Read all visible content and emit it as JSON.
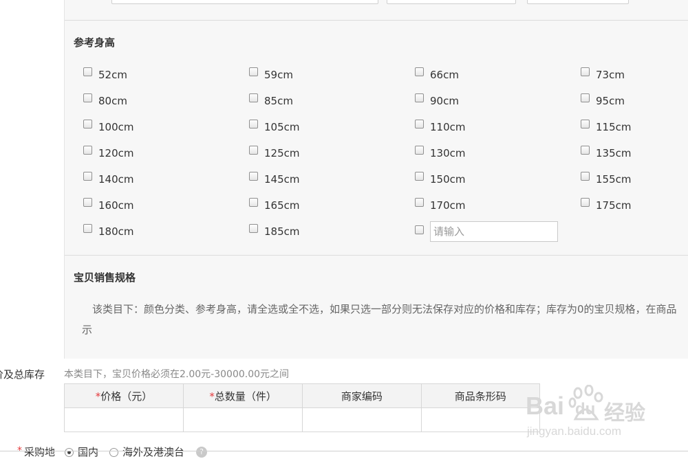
{
  "height_section": {
    "title": "参考身高",
    "options": [
      {
        "label": "52cm"
      },
      {
        "label": "59cm"
      },
      {
        "label": "66cm"
      },
      {
        "label": "73cm"
      },
      {
        "label": "80cm"
      },
      {
        "label": "85cm"
      },
      {
        "label": "90cm"
      },
      {
        "label": "95cm"
      },
      {
        "label": "100cm"
      },
      {
        "label": "105cm"
      },
      {
        "label": "110cm"
      },
      {
        "label": "115cm"
      },
      {
        "label": "120cm"
      },
      {
        "label": "125cm"
      },
      {
        "label": "130cm"
      },
      {
        "label": "135cm"
      },
      {
        "label": "140cm"
      },
      {
        "label": "145cm"
      },
      {
        "label": "150cm"
      },
      {
        "label": "155cm"
      },
      {
        "label": "160cm"
      },
      {
        "label": "165cm"
      },
      {
        "label": "170cm"
      },
      {
        "label": "175cm"
      },
      {
        "label": "180cm"
      },
      {
        "label": "185cm"
      }
    ],
    "custom_placeholder": "请输入"
  },
  "sales_spec": {
    "title": "宝贝销售规格",
    "notice_line1": "该类目下：颜色分类、参考身高，请全选或全不选，如果只选一部分则无法保存对应的价格和库存；库存为0的宝贝规格，在商品",
    "notice_line2": "示"
  },
  "price_stock": {
    "label": "价及总库存",
    "hint": "本类目下，宝贝价格必须在2.00元-30000.00元之间",
    "columns": [
      {
        "required": true,
        "label": "价格（元）"
      },
      {
        "required": true,
        "label": "总数量（件）"
      },
      {
        "required": false,
        "label": "商家编码"
      },
      {
        "required": false,
        "label": "商品条形码"
      }
    ],
    "required_mark": "*"
  },
  "purchase_location": {
    "required_mark": "*",
    "label": "采购地",
    "options": [
      {
        "label": "国内",
        "selected": true
      },
      {
        "label": "海外及港澳台",
        "selected": false
      }
    ],
    "help": "?"
  },
  "watermark": {
    "brand": "Bai",
    "brand2": "du",
    "suffix": "经验",
    "url": "jingyan.baidu.com"
  }
}
